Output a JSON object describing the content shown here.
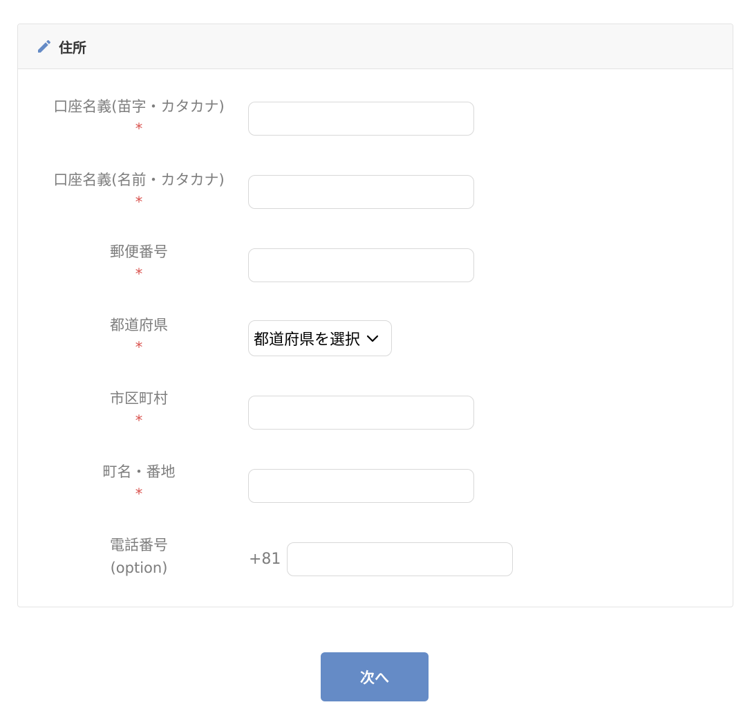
{
  "header": {
    "title": "住所",
    "icon": "pencil-icon"
  },
  "form": {
    "required_mark": "*",
    "fields": {
      "account_last": {
        "label": "口座名義(苗字・カタカナ)",
        "value": "",
        "placeholder": ""
      },
      "account_first": {
        "label": "口座名義(名前・カタカナ)",
        "value": "",
        "placeholder": ""
      },
      "postal": {
        "label": "郵便番号",
        "value": "",
        "placeholder": ""
      },
      "prefecture": {
        "label": "都道府県",
        "selected": "都道府県を選択"
      },
      "city": {
        "label": "市区町村",
        "value": "",
        "placeholder": ""
      },
      "street": {
        "label": "町名・番地",
        "value": "",
        "placeholder": ""
      },
      "phone": {
        "label": "電話番号",
        "optional": "(option)",
        "prefix": "+81",
        "value": "",
        "placeholder": ""
      }
    }
  },
  "actions": {
    "next_label": "次へ"
  },
  "colors": {
    "accent": "#658bc6",
    "required": "#d9534f",
    "label": "#7d7d7d"
  }
}
